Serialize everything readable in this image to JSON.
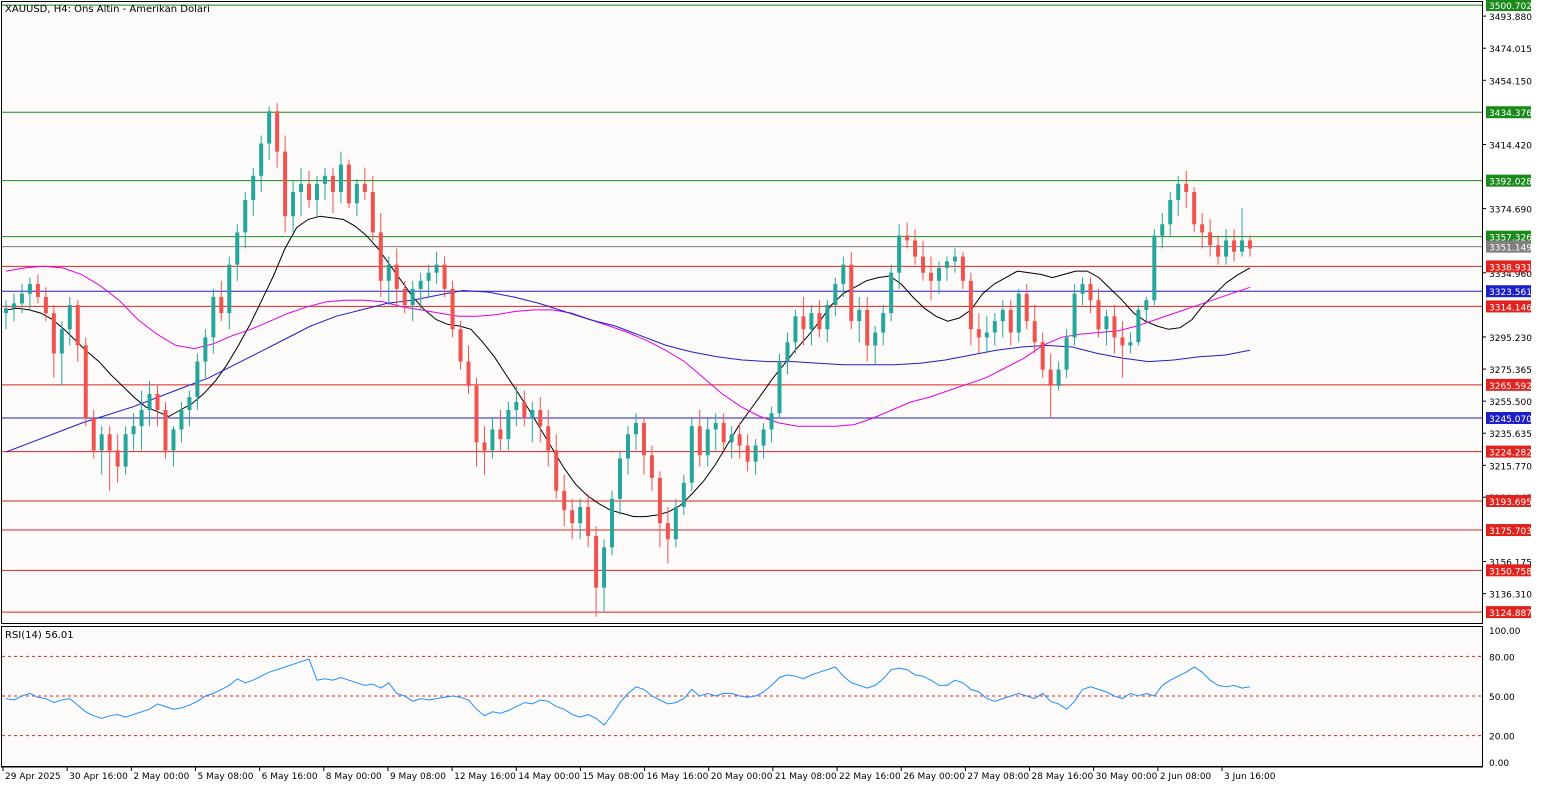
{
  "chart_data": {
    "type": "candlestick",
    "title": "XAUUSD, H4:  Ons Altin - Amerikan Dolari",
    "price_axis": {
      "ylim": [
        3120,
        3502
      ],
      "ticks": [
        "3493.880",
        "3474.015",
        "3454.150",
        "3414.420",
        "3374.690",
        "3334.960",
        "3295.230",
        "3275.365",
        "3255.500",
        "3235.635",
        "3215.770",
        "3196.045",
        "3156.175",
        "3136.310"
      ]
    },
    "time_axis_labels": [
      "29 Apr 2025",
      "30 Apr 16:00",
      "2 May 00:00",
      "5 May 08:00",
      "6 May 16:00",
      "8 May 00:00",
      "9 May 08:00",
      "12 May 16:00",
      "14 May 00:00",
      "15 May 08:00",
      "16 May 16:00",
      "20 May 00:00",
      "21 May 08:00",
      "22 May 16:00",
      "26 May 00:00",
      "27 May 08:00",
      "28 May 16:00",
      "30 May 00:00",
      "2 Jun 08:00",
      "3 Jun 16:00"
    ],
    "levels": [
      {
        "value": 3500.702,
        "label": "3500.702",
        "color": "#1a8a1a"
      },
      {
        "value": 3434.376,
        "label": "3434.376",
        "color": "#1a8a1a"
      },
      {
        "value": 3392.028,
        "label": "3392.028",
        "color": "#1a8a1a"
      },
      {
        "value": 3357.326,
        "label": "3357.326",
        "color": "#1a8a1a"
      },
      {
        "value": 3351.149,
        "label": "3351.149",
        "color": "#7f7f7f"
      },
      {
        "value": 3338.931,
        "label": "3338.931",
        "color": "#e0231f"
      },
      {
        "value": 3323.561,
        "label": "3323.561",
        "color": "#1f1fc8"
      },
      {
        "value": 3314.146,
        "label": "3314.146",
        "color": "#e0231f"
      },
      {
        "value": 3265.592,
        "label": "3265.592",
        "color": "#e0231f"
      },
      {
        "value": 3245.07,
        "label": "3245.070",
        "color": "#1f1fc8"
      },
      {
        "value": 3224.282,
        "label": "3224.282",
        "color": "#e0231f"
      },
      {
        "value": 3193.695,
        "label": "3193.695",
        "color": "#e0231f"
      },
      {
        "value": 3175.703,
        "label": "3175.703",
        "color": "#e0231f"
      },
      {
        "value": 3150.758,
        "label": "3150.758",
        "color": "#e0231f"
      },
      {
        "value": 3124.887,
        "label": "3124.887",
        "color": "#e0231f"
      }
    ],
    "candles": [
      [
        3310,
        3318,
        3300,
        3313
      ],
      [
        3313,
        3322,
        3305,
        3316
      ],
      [
        3316,
        3328,
        3310,
        3322
      ],
      [
        3322,
        3332,
        3312,
        3328
      ],
      [
        3328,
        3334,
        3316,
        3320
      ],
      [
        3320,
        3326,
        3305,
        3310
      ],
      [
        3310,
        3315,
        3270,
        3285
      ],
      [
        3285,
        3305,
        3265,
        3300
      ],
      [
        3300,
        3320,
        3290,
        3315
      ],
      [
        3315,
        3318,
        3280,
        3290
      ],
      [
        3290,
        3295,
        3240,
        3245
      ],
      [
        3245,
        3250,
        3220,
        3225
      ],
      [
        3225,
        3240,
        3210,
        3235
      ],
      [
        3235,
        3240,
        3200,
        3225
      ],
      [
        3225,
        3235,
        3205,
        3215
      ],
      [
        3215,
        3240,
        3210,
        3235
      ],
      [
        3235,
        3248,
        3225,
        3240
      ],
      [
        3240,
        3262,
        3225,
        3250
      ],
      [
        3250,
        3268,
        3240,
        3260
      ],
      [
        3260,
        3265,
        3240,
        3250
      ],
      [
        3250,
        3255,
        3220,
        3225
      ],
      [
        3225,
        3240,
        3215,
        3238
      ],
      [
        3238,
        3255,
        3230,
        3250
      ],
      [
        3250,
        3262,
        3240,
        3258
      ],
      [
        3258,
        3285,
        3250,
        3280
      ],
      [
        3280,
        3300,
        3270,
        3295
      ],
      [
        3295,
        3325,
        3285,
        3320
      ],
      [
        3320,
        3330,
        3305,
        3310
      ],
      [
        3310,
        3345,
        3300,
        3340
      ],
      [
        3340,
        3365,
        3330,
        3360
      ],
      [
        3360,
        3385,
        3350,
        3380
      ],
      [
        3380,
        3400,
        3370,
        3395
      ],
      [
        3395,
        3420,
        3385,
        3415
      ],
      [
        3415,
        3438,
        3405,
        3435
      ],
      [
        3435,
        3440,
        3400,
        3410
      ],
      [
        3410,
        3420,
        3360,
        3370
      ],
      [
        3370,
        3392,
        3360,
        3385
      ],
      [
        3385,
        3400,
        3370,
        3390
      ],
      [
        3390,
        3398,
        3375,
        3380
      ],
      [
        3380,
        3395,
        3370,
        3390
      ],
      [
        3390,
        3400,
        3380,
        3395
      ],
      [
        3395,
        3400,
        3372,
        3385
      ],
      [
        3385,
        3410,
        3378,
        3402
      ],
      [
        3402,
        3405,
        3375,
        3378
      ],
      [
        3378,
        3393,
        3370,
        3390
      ],
      [
        3390,
        3400,
        3380,
        3385
      ],
      [
        3385,
        3395,
        3355,
        3360
      ],
      [
        3360,
        3372,
        3320,
        3330
      ],
      [
        3330,
        3345,
        3315,
        3340
      ],
      [
        3340,
        3350,
        3315,
        3325
      ],
      [
        3325,
        3330,
        3310,
        3315
      ],
      [
        3315,
        3330,
        3305,
        3325
      ],
      [
        3325,
        3335,
        3312,
        3330
      ],
      [
        3330,
        3340,
        3320,
        3335
      ],
      [
        3335,
        3348,
        3328,
        3340
      ],
      [
        3340,
        3345,
        3320,
        3325
      ],
      [
        3325,
        3330,
        3295,
        3300
      ],
      [
        3300,
        3305,
        3275,
        3280
      ],
      [
        3280,
        3290,
        3260,
        3265
      ],
      [
        3265,
        3270,
        3215,
        3230
      ],
      [
        3230,
        3240,
        3210,
        3225
      ],
      [
        3225,
        3245,
        3220,
        3238
      ],
      [
        3238,
        3250,
        3225,
        3232
      ],
      [
        3232,
        3255,
        3225,
        3250
      ],
      [
        3250,
        3265,
        3240,
        3255
      ],
      [
        3255,
        3262,
        3240,
        3245
      ],
      [
        3245,
        3255,
        3230,
        3250
      ],
      [
        3250,
        3258,
        3230,
        3240
      ],
      [
        3240,
        3250,
        3215,
        3225
      ],
      [
        3225,
        3235,
        3195,
        3200
      ],
      [
        3200,
        3210,
        3178,
        3188
      ],
      [
        3188,
        3195,
        3170,
        3180
      ],
      [
        3180,
        3195,
        3170,
        3190
      ],
      [
        3190,
        3198,
        3165,
        3172
      ],
      [
        3172,
        3178,
        3122,
        3140
      ],
      [
        3140,
        3170,
        3125,
        3165
      ],
      [
        3165,
        3200,
        3160,
        3195
      ],
      [
        3195,
        3225,
        3185,
        3220
      ],
      [
        3220,
        3240,
        3210,
        3235
      ],
      [
        3235,
        3248,
        3225,
        3242
      ],
      [
        3242,
        3245,
        3210,
        3222
      ],
      [
        3222,
        3228,
        3200,
        3208
      ],
      [
        3208,
        3212,
        3165,
        3180
      ],
      [
        3180,
        3190,
        3155,
        3170
      ],
      [
        3170,
        3195,
        3165,
        3190
      ],
      [
        3190,
        3210,
        3185,
        3205
      ],
      [
        3205,
        3245,
        3200,
        3240
      ],
      [
        3240,
        3250,
        3215,
        3222
      ],
      [
        3222,
        3245,
        3215,
        3238
      ],
      [
        3238,
        3248,
        3225,
        3242
      ],
      [
        3242,
        3248,
        3225,
        3230
      ],
      [
        3230,
        3240,
        3220,
        3235
      ],
      [
        3235,
        3242,
        3220,
        3228
      ],
      [
        3228,
        3235,
        3212,
        3218
      ],
      [
        3218,
        3232,
        3210,
        3228
      ],
      [
        3228,
        3242,
        3220,
        3238
      ],
      [
        3238,
        3252,
        3230,
        3248
      ],
      [
        3248,
        3285,
        3245,
        3280
      ],
      [
        3280,
        3298,
        3272,
        3292
      ],
      [
        3292,
        3312,
        3285,
        3308
      ],
      [
        3308,
        3320,
        3290,
        3300
      ],
      [
        3300,
        3315,
        3290,
        3310
      ],
      [
        3310,
        3318,
        3295,
        3300
      ],
      [
        3300,
        3318,
        3292,
        3315
      ],
      [
        3315,
        3332,
        3308,
        3328
      ],
      [
        3328,
        3345,
        3320,
        3340
      ],
      [
        3340,
        3348,
        3300,
        3305
      ],
      [
        3305,
        3320,
        3292,
        3312
      ],
      [
        3312,
        3320,
        3280,
        3290
      ],
      [
        3290,
        3302,
        3278,
        3298
      ],
      [
        3298,
        3315,
        3290,
        3310
      ],
      [
        3310,
        3340,
        3305,
        3335
      ],
      [
        3335,
        3365,
        3325,
        3358
      ],
      [
        3358,
        3366,
        3350,
        3355
      ],
      [
        3355,
        3362,
        3340,
        3345
      ],
      [
        3345,
        3355,
        3330,
        3335
      ],
      [
        3335,
        3345,
        3318,
        3330
      ],
      [
        3330,
        3342,
        3322,
        3338
      ],
      [
        3338,
        3345,
        3330,
        3342
      ],
      [
        3342,
        3350,
        3335,
        3345
      ],
      [
        3345,
        3348,
        3325,
        3330
      ],
      [
        3330,
        3335,
        3290,
        3300
      ],
      [
        3300,
        3310,
        3285,
        3295
      ],
      [
        3295,
        3308,
        3285,
        3298
      ],
      [
        3298,
        3310,
        3290,
        3305
      ],
      [
        3305,
        3318,
        3295,
        3312
      ],
      [
        3312,
        3318,
        3290,
        3298
      ],
      [
        3298,
        3325,
        3292,
        3322
      ],
      [
        3322,
        3328,
        3300,
        3305
      ],
      [
        3305,
        3315,
        3285,
        3292
      ],
      [
        3292,
        3298,
        3270,
        3275
      ],
      [
        3275,
        3285,
        3245,
        3265
      ],
      [
        3265,
        3280,
        3262,
        3275
      ],
      [
        3275,
        3300,
        3270,
        3295
      ],
      [
        3295,
        3328,
        3290,
        3322
      ],
      [
        3322,
        3332,
        3315,
        3328
      ],
      [
        3328,
        3332,
        3310,
        3318
      ],
      [
        3318,
        3325,
        3295,
        3300
      ],
      [
        3300,
        3312,
        3290,
        3308
      ],
      [
        3308,
        3315,
        3285,
        3295
      ],
      [
        3295,
        3305,
        3270,
        3290
      ],
      [
        3290,
        3298,
        3285,
        3292
      ],
      [
        3292,
        3315,
        3290,
        3312
      ],
      [
        3312,
        3320,
        3305,
        3318
      ],
      [
        3318,
        3362,
        3315,
        3358
      ],
      [
        3358,
        3372,
        3350,
        3365
      ],
      [
        3365,
        3385,
        3358,
        3380
      ],
      [
        3380,
        3395,
        3370,
        3390
      ],
      [
        3390,
        3398,
        3375,
        3385
      ],
      [
        3385,
        3388,
        3360,
        3365
      ],
      [
        3365,
        3372,
        3350,
        3360
      ],
      [
        3360,
        3368,
        3345,
        3352
      ],
      [
        3352,
        3358,
        3340,
        3345
      ],
      [
        3345,
        3362,
        3340,
        3355
      ],
      [
        3355,
        3362,
        3342,
        3348
      ],
      [
        3348,
        3375,
        3345,
        3355
      ],
      [
        3355,
        3358,
        3345,
        3350
      ]
    ],
    "rsi": {
      "label": "RSI(14) 56.01",
      "ylim": [
        0,
        100
      ],
      "ticks": [
        "100.00",
        "80.00",
        "50.00",
        "20.00",
        "0.00"
      ],
      "levels": [
        80,
        50,
        20
      ],
      "values": [
        48,
        47,
        50,
        52,
        49,
        48,
        45,
        47,
        48,
        43,
        38,
        35,
        33,
        35,
        36,
        34,
        36,
        38,
        40,
        44,
        42,
        40,
        41,
        43,
        46,
        50,
        52,
        55,
        58,
        63,
        60,
        62,
        65,
        68,
        70,
        72,
        74,
        76,
        78,
        62,
        63,
        62,
        64,
        62,
        60,
        58,
        59,
        56,
        60,
        52,
        50,
        46,
        48,
        47,
        48,
        49,
        50,
        49,
        47,
        40,
        35,
        38,
        37,
        39,
        42,
        45,
        44,
        47,
        46,
        42,
        40,
        36,
        34,
        36,
        33,
        28,
        36,
        45,
        52,
        57,
        55,
        50,
        47,
        44,
        45,
        48,
        55,
        50,
        52,
        50,
        52,
        52,
        50,
        49,
        50,
        53,
        58,
        64,
        66,
        65,
        63,
        66,
        68,
        70,
        72,
        65,
        60,
        58,
        56,
        58,
        63,
        70,
        71,
        70,
        66,
        65,
        62,
        58,
        58,
        62,
        60,
        55,
        53,
        48,
        46,
        48,
        50,
        52,
        50,
        48,
        52,
        46,
        44,
        40,
        46,
        55,
        57,
        55,
        53,
        50,
        48,
        52,
        50,
        52,
        50,
        58,
        62,
        65,
        68,
        72,
        68,
        62,
        58,
        57,
        58,
        56,
        57
      ]
    },
    "ma_lines": [
      {
        "name": "fast",
        "color": "#000000",
        "values": [
          3312,
          3313,
          3312,
          3310,
          3306,
          3300,
          3293,
          3286,
          3280,
          3272,
          3265,
          3258,
          3252,
          3249,
          3246,
          3250,
          3254,
          3260,
          3268,
          3278,
          3290,
          3303,
          3318,
          3333,
          3350,
          3363,
          3368,
          3370,
          3369,
          3368,
          3364,
          3358,
          3350,
          3340,
          3330,
          3320,
          3312,
          3306,
          3303,
          3302,
          3300,
          3292,
          3283,
          3272,
          3261,
          3250,
          3238,
          3226,
          3214,
          3204,
          3197,
          3192,
          3188,
          3186,
          3184,
          3184,
          3185,
          3187,
          3191,
          3198,
          3206,
          3216,
          3228,
          3240,
          3250,
          3260,
          3270,
          3279,
          3288,
          3296,
          3305,
          3315,
          3322,
          3326,
          3330,
          3332,
          3333,
          3328,
          3320,
          3313,
          3308,
          3305,
          3307,
          3312,
          3322,
          3328,
          3332,
          3336,
          3335,
          3334,
          3332,
          3334,
          3336,
          3336,
          3332,
          3325,
          3318,
          3310,
          3305,
          3302,
          3300,
          3301,
          3306,
          3315,
          3322,
          3329,
          3334,
          3338
        ]
      },
      {
        "name": "mid",
        "color": "#e000e0",
        "values": [
          3336,
          3338,
          3339,
          3338,
          3334,
          3327,
          3318,
          3306,
          3297,
          3290,
          3288,
          3291,
          3296,
          3300,
          3305,
          3310,
          3314,
          3317,
          3318,
          3318,
          3317,
          3314,
          3312,
          3310,
          3308,
          3308,
          3309,
          3311,
          3312,
          3312,
          3310,
          3306,
          3302,
          3298,
          3293,
          3287,
          3280,
          3270,
          3260,
          3252,
          3246,
          3242,
          3240,
          3240,
          3240,
          3241,
          3245,
          3250,
          3255,
          3258,
          3262,
          3266,
          3270,
          3276,
          3282,
          3290,
          3295,
          3297,
          3298,
          3299,
          3302,
          3306,
          3310,
          3314,
          3318,
          3322,
          3326
        ]
      },
      {
        "name": "slow",
        "color": "#1f1fc8",
        "values": [
          3224,
          3230,
          3236,
          3242,
          3247,
          3252,
          3258,
          3264,
          3270,
          3278,
          3286,
          3294,
          3302,
          3308,
          3312,
          3316,
          3318,
          3321,
          3324,
          3323,
          3320,
          3316,
          3311,
          3306,
          3302,
          3296,
          3290,
          3286,
          3283,
          3281,
          3280,
          3280,
          3279,
          3278,
          3278,
          3278,
          3279,
          3281,
          3284,
          3287,
          3289,
          3290,
          3289,
          3285,
          3282,
          3280,
          3281,
          3283,
          3284,
          3287
        ]
      }
    ]
  }
}
